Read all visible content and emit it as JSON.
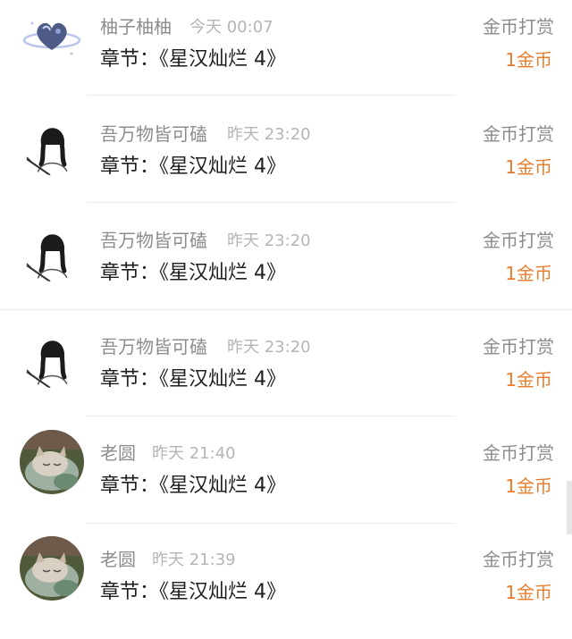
{
  "reward_label": "金币打赏",
  "accent_color": "#ea7d2c",
  "items": [
    {
      "avatar": "heart-planet-icon",
      "name": "柚子柚柚",
      "time": "今天 00:07",
      "chapter": "章节：《星汉灿烂 4》",
      "reward_label": "金币打赏",
      "amount": "1金币"
    },
    {
      "avatar": "braided-girl-sketch-icon",
      "name": "吾万物皆可磕",
      "time": "昨天 23:20",
      "chapter": "章节：《星汉灿烂 4》",
      "reward_label": "金币打赏",
      "amount": "1金币"
    },
    {
      "avatar": "braided-girl-sketch-icon",
      "name": "吾万物皆可磕",
      "time": "昨天 23:20",
      "chapter": "章节：《星汉灿烂 4》",
      "reward_label": "金币打赏",
      "amount": "1金币"
    },
    {
      "avatar": "braided-girl-sketch-icon",
      "name": "吾万物皆可磕",
      "time": "昨天 23:20",
      "chapter": "章节：《星汉灿烂 4》",
      "reward_label": "金币打赏",
      "amount": "1金币"
    },
    {
      "avatar": "sleeping-cat-photo-icon",
      "name": "老圆",
      "time": "昨天 21:40",
      "chapter": "章节：《星汉灿烂 4》",
      "reward_label": "金币打赏",
      "amount": "1金币"
    },
    {
      "avatar": "sleeping-cat-photo-icon",
      "name": "老圆",
      "time": "昨天 21:39",
      "chapter": "章节：《星汉灿烂 4》",
      "reward_label": "金币打赏",
      "amount": "1金币"
    }
  ]
}
